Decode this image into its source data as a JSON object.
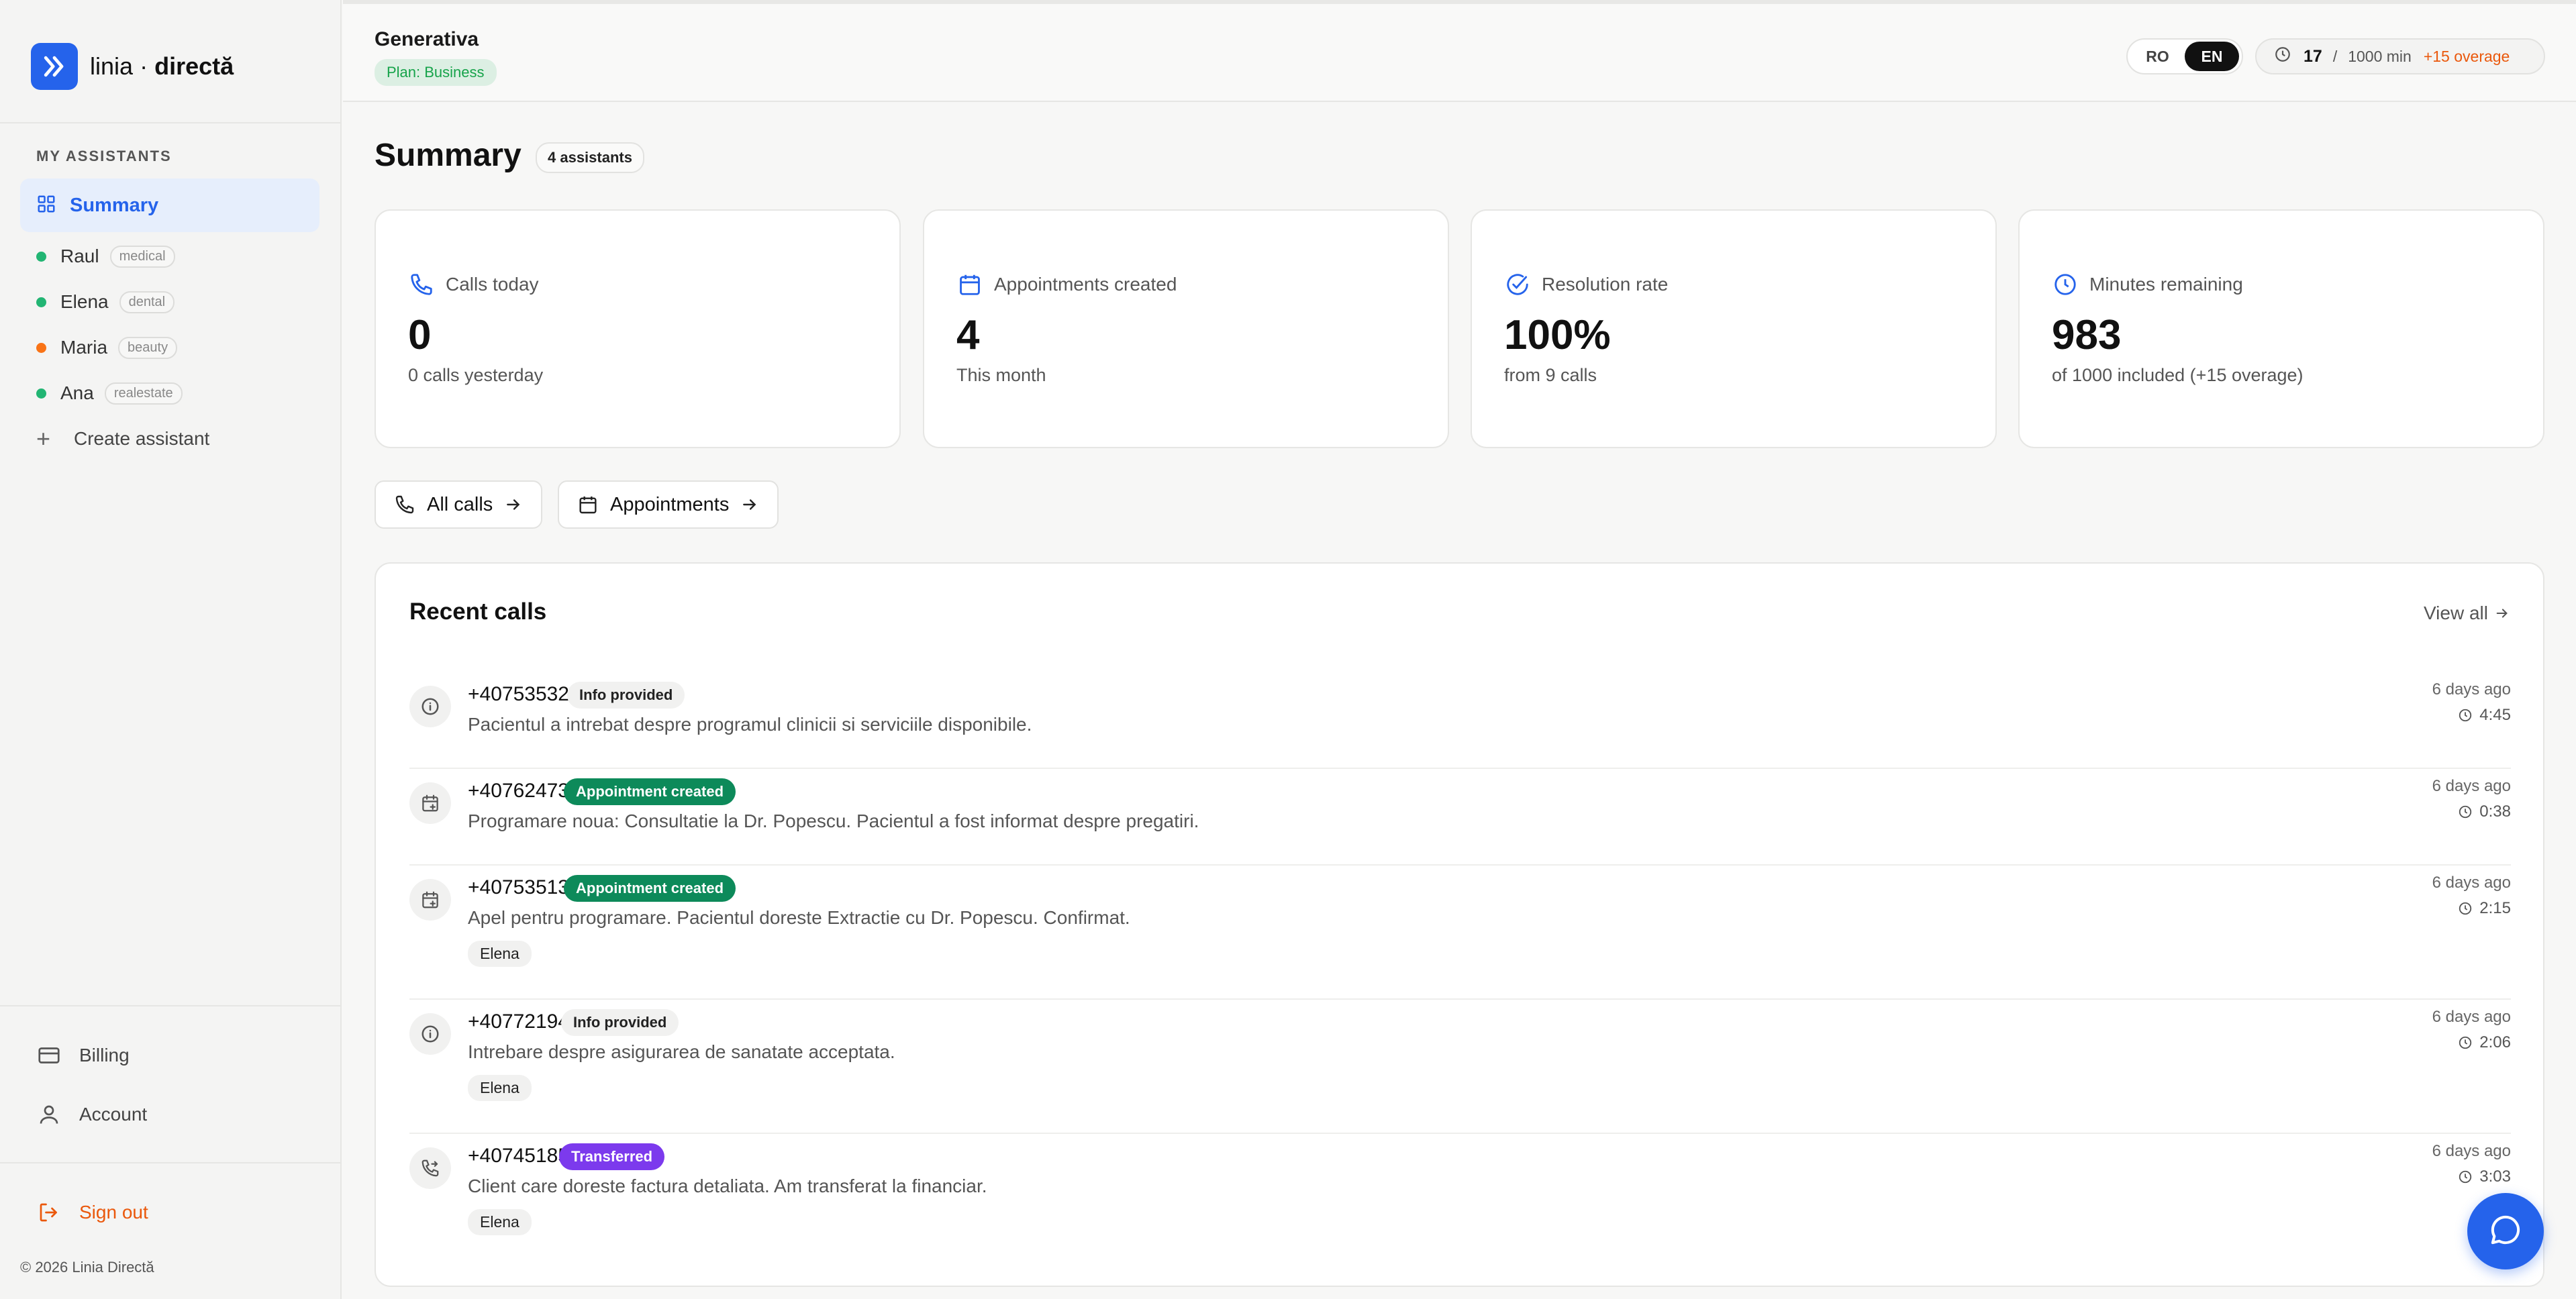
{
  "brand": {
    "name_part1": "linia",
    "separator": "·",
    "name_part2": "directă"
  },
  "sidebar": {
    "section_label": "MY ASSISTANTS",
    "summary_label": "Summary",
    "assistants": [
      {
        "name": "Raul",
        "tag": "medical",
        "status_color": "#22b573"
      },
      {
        "name": "Elena",
        "tag": "dental",
        "status_color": "#22b573"
      },
      {
        "name": "Maria",
        "tag": "beauty",
        "status_color": "#f97316"
      },
      {
        "name": "Ana",
        "tag": "realestate",
        "status_color": "#22b573"
      }
    ],
    "create_label": "Create assistant",
    "billing_label": "Billing",
    "account_label": "Account",
    "signout_label": "Sign out",
    "copyright": "© 2026 Linia Directă"
  },
  "topbar": {
    "org_name": "Generativa",
    "plan": "Plan: Business",
    "lang_ro": "RO",
    "lang_en": "EN",
    "usage_used": "17",
    "usage_sep": "/",
    "usage_total": "1000 min",
    "usage_overage": "+15 overage"
  },
  "page": {
    "title": "Summary",
    "count_badge": "4 assistants"
  },
  "stats": [
    {
      "label": "Calls today",
      "value": "0",
      "sub": "0 calls yesterday"
    },
    {
      "label": "Appointments created",
      "value": "4",
      "sub": "This month"
    },
    {
      "label": "Resolution rate",
      "value": "100%",
      "sub": "from 9 calls"
    },
    {
      "label": "Minutes remaining",
      "value": "983",
      "sub": "of 1000 included (+15 overage)"
    }
  ],
  "quick_links": {
    "all_calls": "All calls",
    "appointments": "Appointments"
  },
  "recent": {
    "title": "Recent calls",
    "view_all": "View all",
    "calls": [
      {
        "phone": "+40753532343",
        "badge": "Info provided",
        "summary": "Pacientul a intrebat despre programul clinicii si serviciile disponibile.",
        "assistant": "",
        "time": "6 days ago",
        "duration": "4:45"
      },
      {
        "phone": "+40762473652",
        "badge": "Appointment created",
        "summary": "Programare noua: Consultatie la Dr. Popescu. Pacientul a fost informat despre pregatiri.",
        "assistant": "",
        "time": "6 days ago",
        "duration": "0:38"
      },
      {
        "phone": "+40753513366",
        "badge": "Appointment created",
        "summary": "Apel pentru programare. Pacientul doreste Extractie cu Dr. Popescu. Confirmat.",
        "assistant": "Elena",
        "time": "6 days ago",
        "duration": "2:15"
      },
      {
        "phone": "+40772194142",
        "badge": "Info provided",
        "summary": "Intrebare despre asigurarea de sanatate acceptata.",
        "assistant": "Elena",
        "time": "6 days ago",
        "duration": "2:06"
      },
      {
        "phone": "+40745185719",
        "badge": "Transferred",
        "summary": "Client care doreste factura detaliata. Am transferat la financiar.",
        "assistant": "Elena",
        "time": "6 days ago",
        "duration": "3:03"
      }
    ]
  },
  "colors": {
    "accent": "#2563eb",
    "success": "#0d8a5a",
    "transfer": "#7c3aed",
    "warning": "#ea580c"
  }
}
